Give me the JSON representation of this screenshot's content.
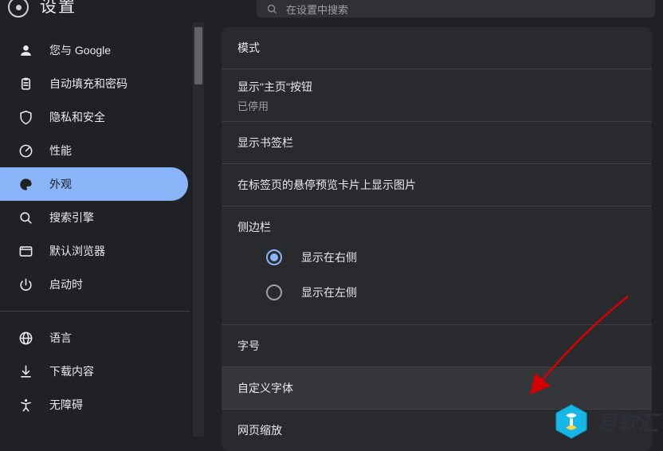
{
  "header": {
    "title": "设置",
    "search_placeholder": "在设置中搜索"
  },
  "sidebar": {
    "items": [
      {
        "icon": "person",
        "label": "您与 Google"
      },
      {
        "icon": "clipboard",
        "label": "自动填充和密码"
      },
      {
        "icon": "shield",
        "label": "隐私和安全"
      },
      {
        "icon": "gauge",
        "label": "性能"
      },
      {
        "icon": "palette",
        "label": "外观",
        "active": true
      },
      {
        "icon": "search",
        "label": "搜索引擎"
      },
      {
        "icon": "browser",
        "label": "默认浏览器"
      },
      {
        "icon": "power",
        "label": "启动时"
      }
    ],
    "items2": [
      {
        "icon": "globe",
        "label": "语言"
      },
      {
        "icon": "download",
        "label": "下载内容"
      },
      {
        "icon": "accessibility",
        "label": "无障碍"
      }
    ]
  },
  "main": {
    "rows": {
      "mode": "模式",
      "home_btn_title": "显示\"主页\"按钮",
      "home_btn_status": "已停用",
      "bookmarks_bar": "显示书签栏",
      "hover_preview": "在标签页的悬停预览卡片上显示图片",
      "side_panel": "侧边栏",
      "radio_right": "显示在右侧",
      "radio_left": "显示在左侧",
      "font_size": "字号",
      "custom_font": "自定义字体",
      "page_zoom": "网页缩放"
    },
    "side_panel_selected": "right"
  },
  "watermark": {
    "text": "易软汇"
  }
}
